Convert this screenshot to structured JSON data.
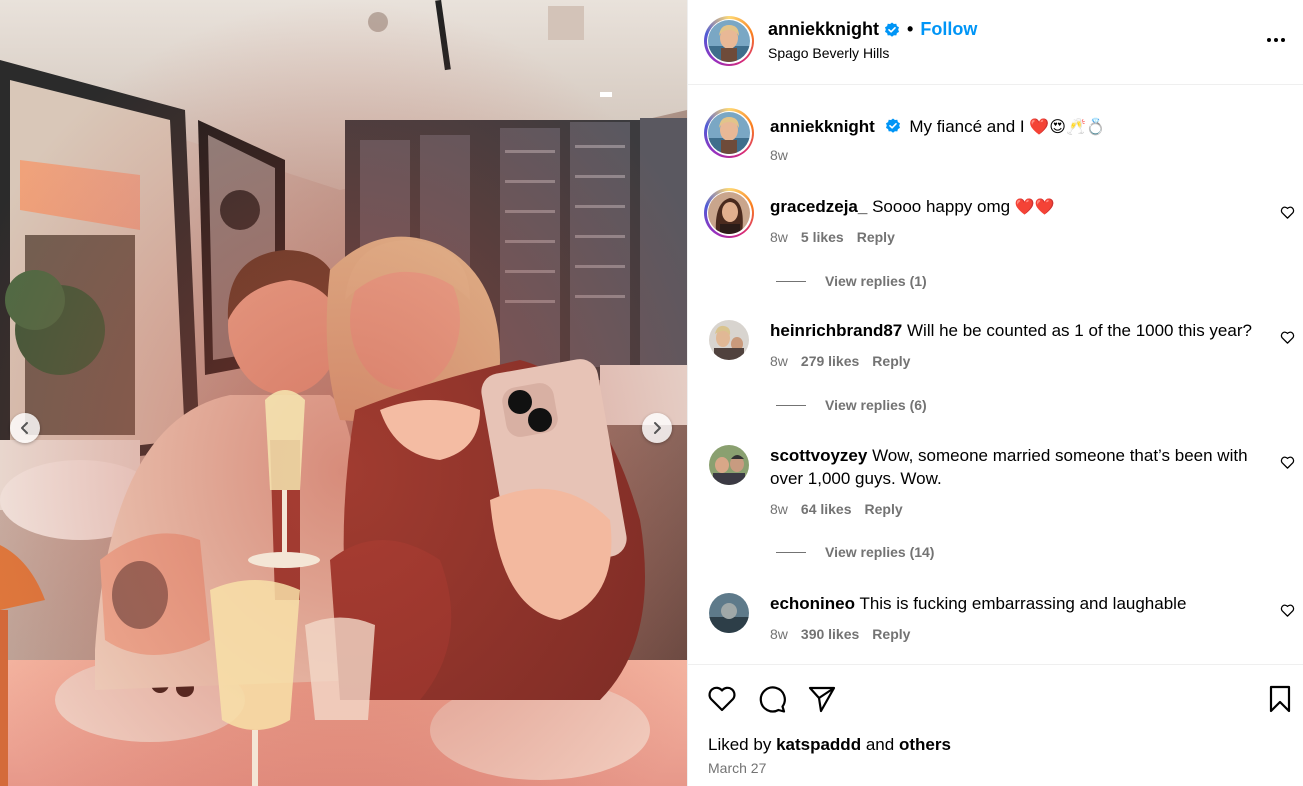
{
  "post": {
    "username": "anniekknight",
    "follow_label": "Follow",
    "separator": "•",
    "location": "Spago Beverly Hills"
  },
  "caption": {
    "username": "anniekknight",
    "text": "My fiancé and I",
    "emojis": "❤️😍🥂💍",
    "time": "8w"
  },
  "comments": [
    {
      "username": "gracedzeja_",
      "text": "Soooo happy omg",
      "emojis": "❤️❤️",
      "time": "8w",
      "likes": "5 likes",
      "reply": "Reply",
      "view_replies": "View replies (1)"
    },
    {
      "username": "heinrichbrand87",
      "text": "Will he be counted as 1 of the 1000 this year?",
      "emojis": "",
      "time": "8w",
      "likes": "279 likes",
      "reply": "Reply",
      "view_replies": "View replies (6)"
    },
    {
      "username": "scottvoyzey",
      "text": "Wow, someone married someone that’s been with over 1,000 guys. Wow.",
      "emojis": "",
      "time": "8w",
      "likes": "64 likes",
      "reply": "Reply",
      "view_replies": "View replies (14)"
    },
    {
      "username": "echonineo",
      "text": "This is fucking embarrassing and laughable",
      "emojis": "",
      "time": "8w",
      "likes": "390 likes",
      "reply": "Reply",
      "view_replies": ""
    }
  ],
  "footer": {
    "liked_by_prefix": "Liked by",
    "liked_by_user": "katspaddd",
    "liked_by_and": "and",
    "liked_by_others": "others",
    "date": "March 27"
  },
  "icons": {
    "verified": "verified-badge-icon",
    "more": "more-options-icon",
    "like": "heart-icon",
    "comment": "comment-icon",
    "share": "paper-plane-icon",
    "save": "bookmark-icon",
    "carousel_prev": "chevron-left-icon",
    "carousel_next": "chevron-right-icon"
  },
  "colors": {
    "accent": "#0095f6",
    "secondary_text": "#737373",
    "divider": "#efefef"
  }
}
